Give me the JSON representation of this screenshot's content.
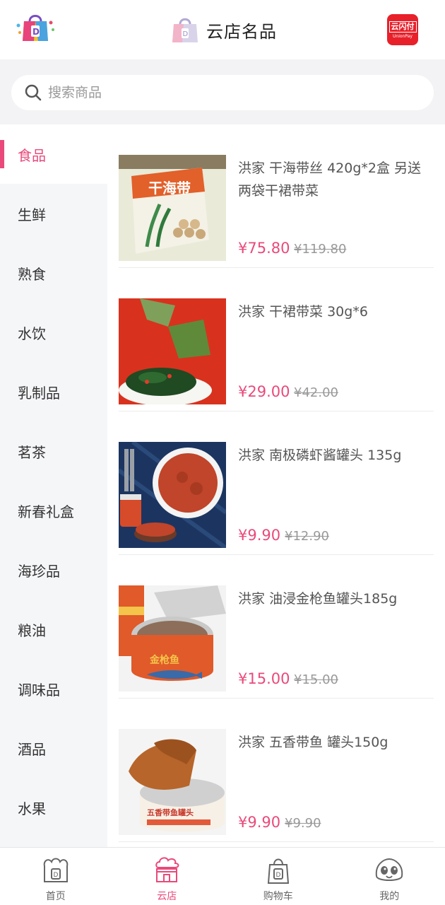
{
  "header": {
    "title": "云店名品",
    "unionpay_line1": "云闪付",
    "unionpay_line2": "UnionPay"
  },
  "search": {
    "placeholder": "搜索商品"
  },
  "sidebar": {
    "items": [
      {
        "label": "食品"
      },
      {
        "label": "生鲜"
      },
      {
        "label": "熟食"
      },
      {
        "label": "水饮"
      },
      {
        "label": "乳制品"
      },
      {
        "label": "茗茶"
      },
      {
        "label": "新春礼盒"
      },
      {
        "label": "海珍品"
      },
      {
        "label": "粮油"
      },
      {
        "label": "调味品"
      },
      {
        "label": "酒品"
      },
      {
        "label": "水果"
      }
    ]
  },
  "products": [
    {
      "name": "洪家 干海带丝 420g*2盒 另送两袋干裙带菜",
      "price": "¥75.80",
      "original_price": "¥119.80",
      "image_text": "干海带"
    },
    {
      "name": "洪家 干裙带菜 30g*6",
      "price": "¥29.00",
      "original_price": "¥42.00"
    },
    {
      "name": "洪家 南极磷虾酱罐头 135g",
      "price": "¥9.90",
      "original_price": "¥12.90"
    },
    {
      "name": "洪家 油浸金枪鱼罐头185g",
      "price": "¥15.00",
      "original_price": "¥15.00",
      "image_text": "金枪鱼"
    },
    {
      "name": "洪家 五香带鱼 罐头150g",
      "price": "¥9.90",
      "original_price": "¥9.90",
      "image_text": "五香带鱼罐头"
    }
  ],
  "tabbar": {
    "items": [
      {
        "label": "首页"
      },
      {
        "label": "云店"
      },
      {
        "label": "购物车"
      },
      {
        "label": "我的"
      }
    ]
  },
  "colors": {
    "accent": "#e94a7b",
    "unionpay": "#e8202a"
  }
}
